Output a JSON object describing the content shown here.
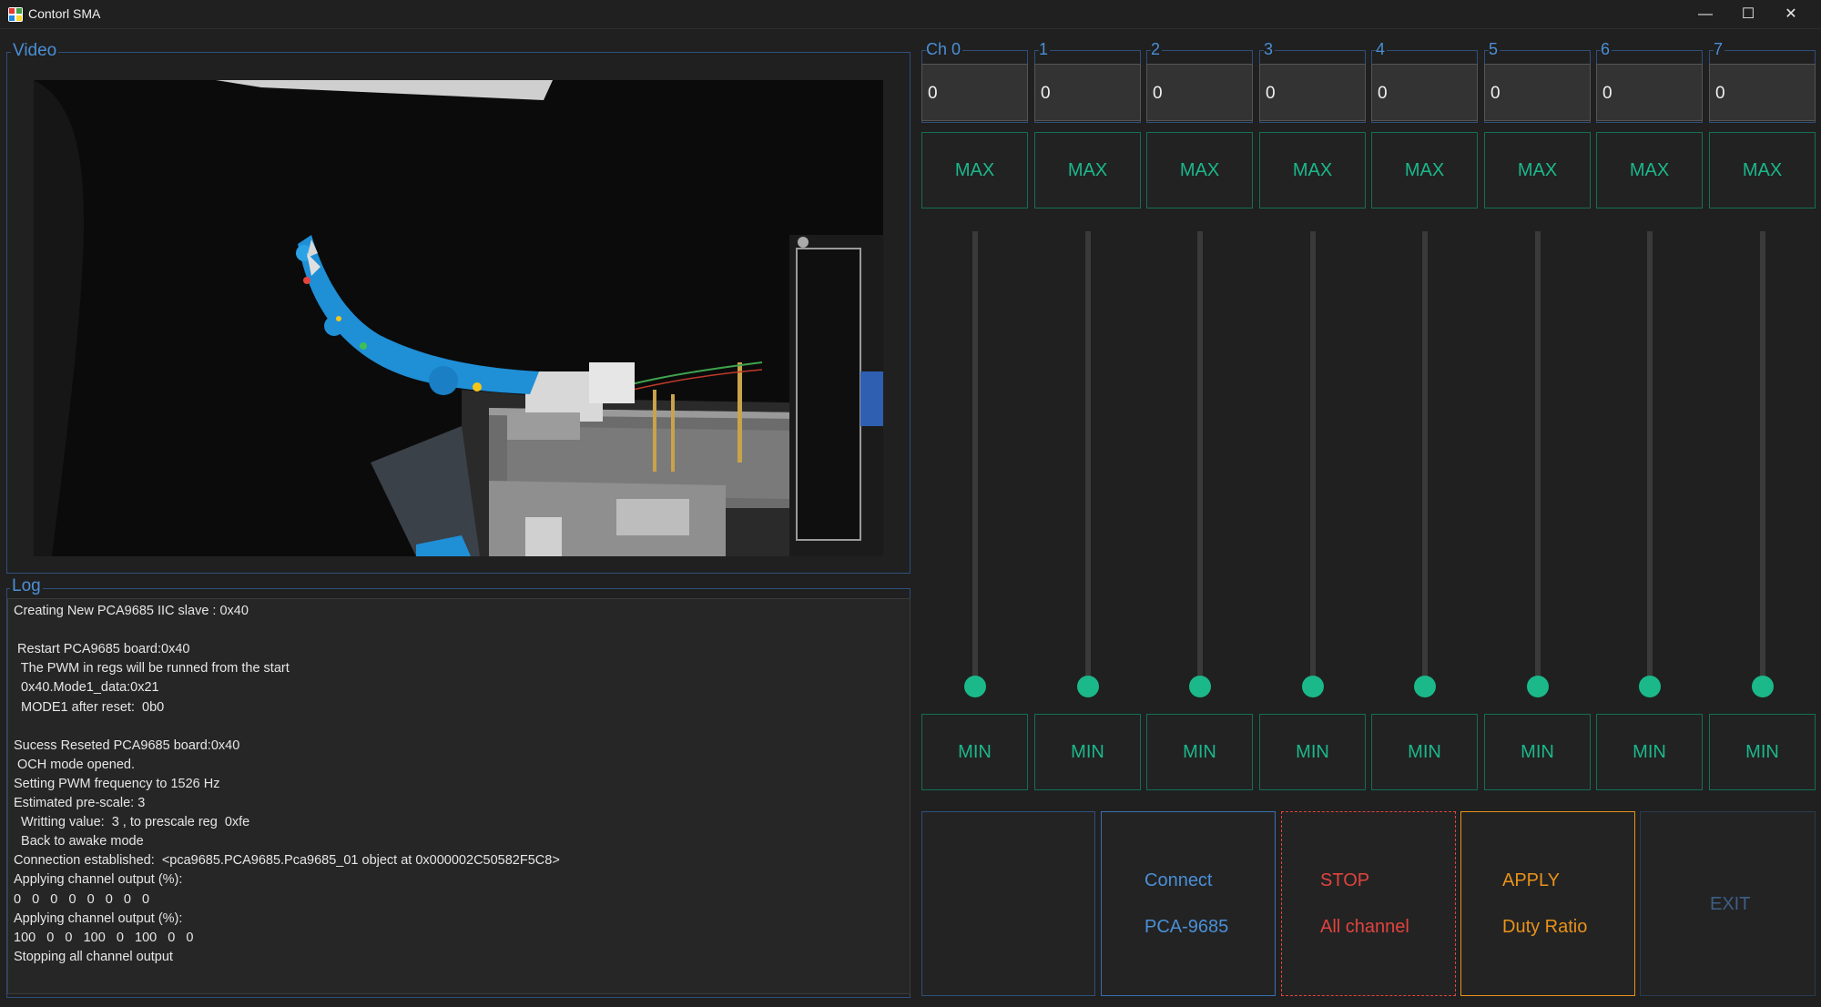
{
  "window": {
    "title": "Contorl SMA"
  },
  "video": {
    "title": "Video"
  },
  "log": {
    "title": "Log",
    "lines": [
      "Creating New PCA9685 IIC slave : 0x40",
      "",
      " Restart PCA9685 board:0x40",
      "  The PWM in regs will be runned from the start",
      "  0x40.Mode1_data:0x21",
      "  MODE1 after reset:  0b0",
      "",
      "Sucess Reseted PCA9685 board:0x40",
      " OCH mode opened.",
      "Setting PWM frequency to 1526 Hz",
      "Estimated pre-scale: 3",
      "  Writting value:  3 , to prescale reg  0xfe",
      "  Back to awake mode",
      "Connection established:  <pca9685.PCA9685.Pca9685_01 object at 0x000002C50582F5C8>",
      "Applying channel output (%):",
      "0   0   0   0   0   0   0   0",
      "Applying channel output (%):",
      "100   0   0   100   0   100   0   0",
      "Stopping all channel output"
    ]
  },
  "channels": [
    {
      "label": "Ch 0",
      "value": "0",
      "max_label": "MAX",
      "min_label": "MIN",
      "level": 0
    },
    {
      "label": "1",
      "value": "0",
      "max_label": "MAX",
      "min_label": "MIN",
      "level": 0
    },
    {
      "label": "2",
      "value": "0",
      "max_label": "MAX",
      "min_label": "MIN",
      "level": 0
    },
    {
      "label": "3",
      "value": "0",
      "max_label": "MAX",
      "min_label": "MIN",
      "level": 0
    },
    {
      "label": "4",
      "value": "0",
      "max_label": "MAX",
      "min_label": "MIN",
      "level": 0
    },
    {
      "label": "5",
      "value": "0",
      "max_label": "MAX",
      "min_label": "MIN",
      "level": 0
    },
    {
      "label": "6",
      "value": "0",
      "max_label": "MAX",
      "min_label": "MIN",
      "level": 0
    },
    {
      "label": "7",
      "value": "0",
      "max_label": "MAX",
      "min_label": "MIN",
      "level": 0
    }
  ],
  "actions": {
    "connect": {
      "line1": "Connect",
      "line2": "PCA-9685"
    },
    "stop": {
      "line1": "STOP",
      "line2": "All channel"
    },
    "apply": {
      "line1": "APPLY",
      "line2": "Duty Ratio"
    },
    "exit": {
      "label": "EXIT"
    }
  },
  "colors": {
    "accent_blue": "#4a8fd6",
    "accent_green": "#1bb88a",
    "stop_red": "#e0443e",
    "apply_orange": "#e8921a",
    "exit_gray": "#3d5f86"
  }
}
